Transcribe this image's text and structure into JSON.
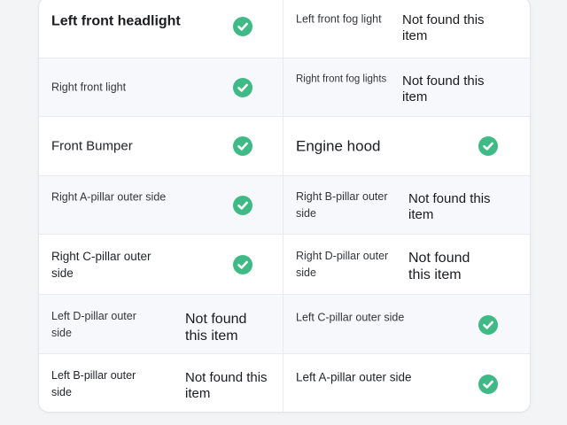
{
  "status_color": "#3fba86",
  "rows": [
    {
      "left": {
        "label": "Left front headlight",
        "status": "check"
      },
      "right": {
        "label": "Left front fog light",
        "status": "not_found",
        "status_text": "Not found this item"
      }
    },
    {
      "left": {
        "label": "Right front light",
        "status": "check"
      },
      "right": {
        "label": "Right front fog lights",
        "status": "not_found",
        "status_text": "Not found this item"
      }
    },
    {
      "left": {
        "label": "Front Bumper",
        "status": "check"
      },
      "right": {
        "label": "Engine hood",
        "status": "check"
      }
    },
    {
      "left": {
        "label": "Right A-pillar outer side",
        "status": "check"
      },
      "right": {
        "label": "Right B-pillar outer side",
        "status": "not_found",
        "status_text": "Not found this item"
      }
    },
    {
      "left": {
        "label": "Right C-pillar outer side",
        "status": "check"
      },
      "right": {
        "label": "Right D-pillar outer side",
        "status": "not_found",
        "status_text": "Not found this item"
      }
    },
    {
      "left": {
        "label": "Left D-pillar outer side",
        "status": "not_found",
        "status_text": "Not found this item"
      },
      "right": {
        "label": "Left C-pillar outer side",
        "status": "check"
      }
    },
    {
      "left": {
        "label": "Left B-pillar outer side",
        "status": "not_found",
        "status_text": "Not found this item"
      },
      "right": {
        "label": "Left A-pillar outer side",
        "status": "check"
      }
    }
  ]
}
